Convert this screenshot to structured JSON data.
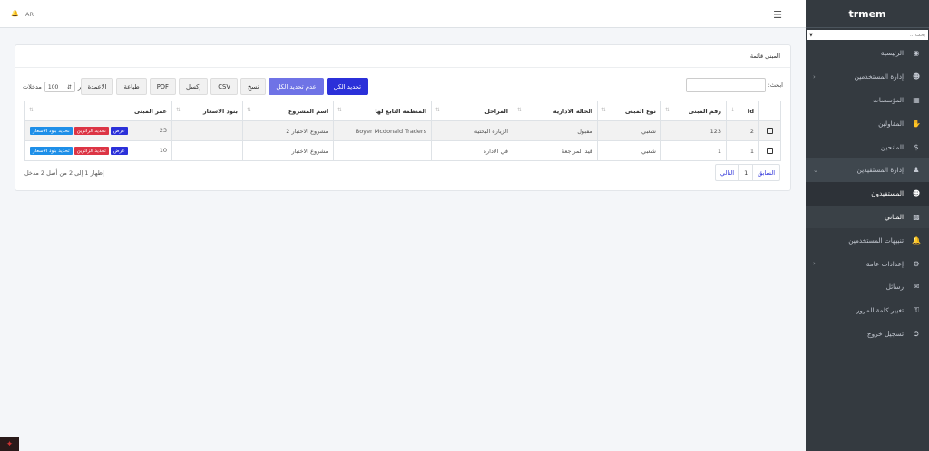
{
  "brand": "trmem",
  "sidebar": {
    "search_placeholder": "بحث...",
    "items": [
      {
        "label": "الرئيسية"
      },
      {
        "label": "إدارة المستخدمين"
      },
      {
        "label": "المؤسسات"
      },
      {
        "label": "المقاولين"
      },
      {
        "label": "المانحين"
      },
      {
        "label": "إدارة المستفيدين"
      },
      {
        "label": "المستفيدون"
      },
      {
        "label": "المباني"
      },
      {
        "label": "تنبيهات المستخدمين"
      },
      {
        "label": "إعدادات عامة"
      },
      {
        "label": "رسائل"
      },
      {
        "label": "تغيير كلمة المرور"
      },
      {
        "label": "تسجيل خروج"
      }
    ]
  },
  "topbar": {
    "lang": "AR"
  },
  "card": {
    "title": "المبنى قائمة",
    "buttons": {
      "select_all": "تحديد الكل",
      "deselect_all": "عدم تحديد الكل",
      "copy": "نسخ",
      "csv": "CSV",
      "excel": "إكسل",
      "pdf": "PDF",
      "print": "طباعة",
      "columns": "الاعمدة"
    },
    "length": {
      "show": "أظهر",
      "value": "100",
      "entries": "مدخلات"
    },
    "search_label": "ابحث:",
    "table": {
      "headers": {
        "id": "id",
        "number": "رقم المبنى",
        "type": "نوع المبنى",
        "admin": "الحالة الادارية",
        "stages": "المراحل",
        "org": "المنظمة التابع لها",
        "project": "اسم المشروع",
        "prices": "بنود الاسعار",
        "age": "عمر المبنى"
      },
      "rows": [
        {
          "id": "2",
          "number": "123",
          "type": "شعبي",
          "admin": "مقبول",
          "stages": "الزيارة البحثيه",
          "org": "Boyer Mcdonald Traders",
          "project": "مشروع الاختبار 2",
          "prices": "",
          "age": "23"
        },
        {
          "id": "1",
          "number": "1",
          "type": "شعبي",
          "admin": "قيد المراجعة",
          "stages": "في الاداره",
          "org": "",
          "project": "مشروع الاختبار",
          "prices": "",
          "age": "10"
        }
      ],
      "actions": {
        "view": "عرض",
        "visitors": "تحديد الزائرين",
        "prices": "تحديد بنود الاسعار"
      }
    },
    "info": "إظهار 1 إلى 2 من أصل 2 مدخل",
    "pager": {
      "prev": "السابق",
      "page": "1",
      "next": "التالي"
    }
  },
  "colors": {
    "primary": "#2b30d9",
    "secondary": "#6f73e6",
    "danger": "#dc3545",
    "info": "#1e8fe8",
    "sidebar": "#343a40"
  }
}
